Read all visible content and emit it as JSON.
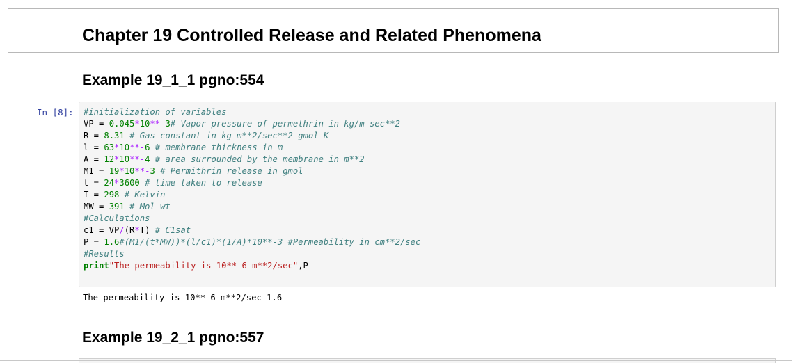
{
  "chapter": {
    "title": "Chapter 19 Controlled Release and Related Phenomena"
  },
  "examples": [
    {
      "title": "Example 19_1_1 pgno:554"
    },
    {
      "title": "Example 19_2_1 pgno:557"
    }
  ],
  "cell": {
    "prompt": "In [8]:",
    "code_lines": [
      "#initialization of variables",
      "VP = 0.045*10**-3# Vapor pressure of permethrin in kg/m-sec**2",
      "R = 8.31 # Gas constant in kg-m**2/sec**2-gmol-K",
      "l = 63*10**-6 # membrane thickness in m",
      "A = 12*10**-4 # area surrounded by the membrane in m**2",
      "M1 = 19*10**-3 # Permithrin release in gmol",
      "t = 24*3600 # time taken to release",
      "T = 298 # Kelvin",
      "MW = 391 # Mol wt",
      "#Calculations",
      "c1 = VP/(R*T) # C1sat",
      "P = 1.6#(M1/(t*MW))*(l/c1)*(1/A)*10**-3 #Permeability in cm**2/sec",
      "#Results",
      "print\"The permeability is 10**-6 m**2/sec\",P"
    ],
    "output": "The permeability is 10**-6 m**2/sec 1.6"
  },
  "colors": {
    "prompt": "#303f9f",
    "comment": "#408080",
    "number": "#008000",
    "operator": "#aa22ff",
    "keyword": "#008000",
    "string": "#ba2121",
    "cell_background": "#f5f5f5",
    "cell_border": "#cfcfcf"
  }
}
